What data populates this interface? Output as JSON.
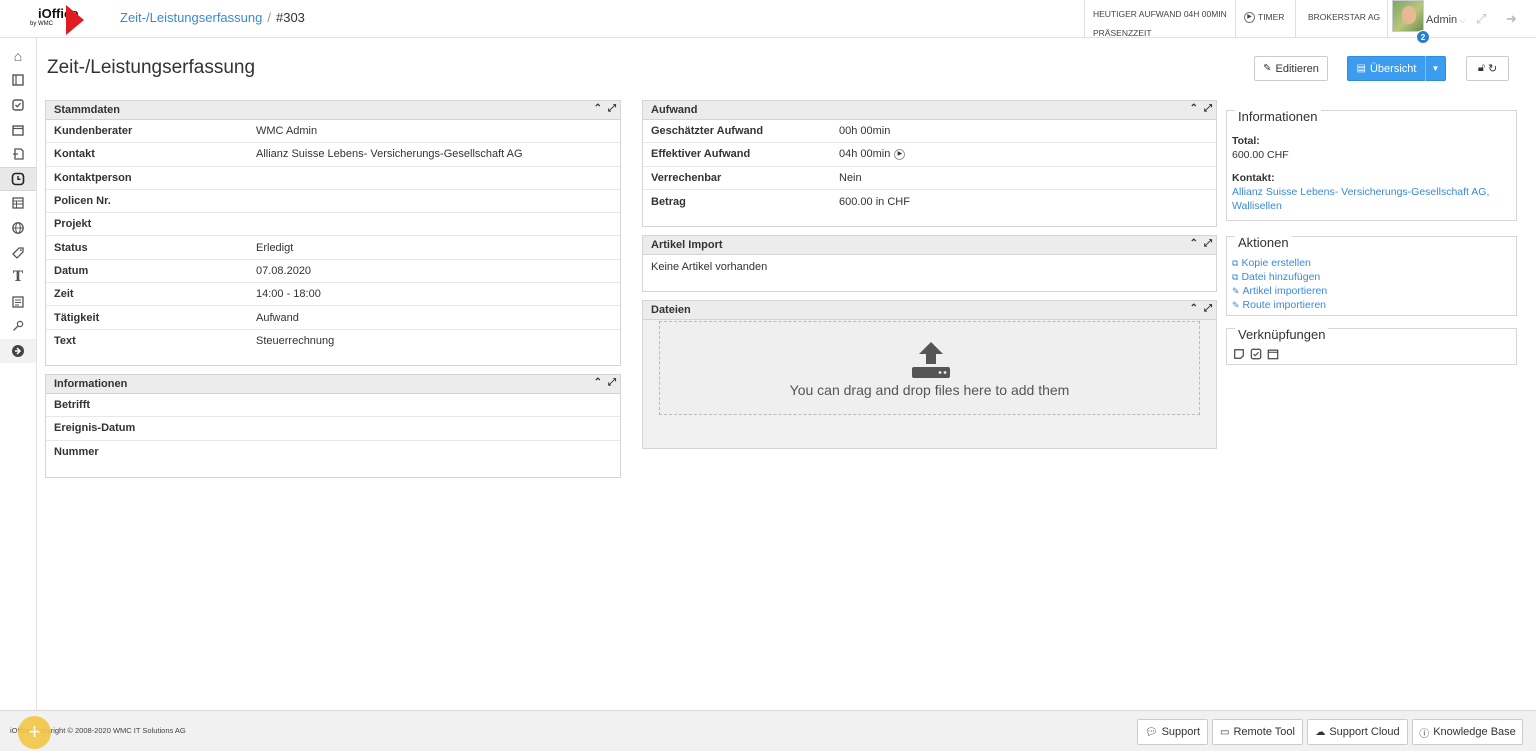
{
  "header": {
    "breadcrumb_link": "Zeit-/Leistungserfassung",
    "breadcrumb_sep": "/",
    "breadcrumb_current": "#303",
    "effort_line1": "HEUTIGER AUFWAND 04H 00MIN",
    "effort_line2": "PRÄSENZZEIT",
    "timer_label": "TIMER",
    "company": "BROKERSTAR AG",
    "user_name": "Admin",
    "notification_count": "2",
    "logo_text": "iOffice",
    "logo_sub": "by WMC"
  },
  "page": {
    "title": "Zeit-/Leistungserfassung",
    "edit_button": "Editieren",
    "overview_button": "Übersicht"
  },
  "stammdaten": {
    "title": "Stammdaten",
    "rows": [
      {
        "label": "Kundenberater",
        "value": "WMC Admin"
      },
      {
        "label": "Kontakt",
        "value": "Allianz Suisse Lebens- Versicherungs-Gesellschaft AG"
      },
      {
        "label": "Kontaktperson",
        "value": ""
      },
      {
        "label": "Policen Nr.",
        "value": ""
      },
      {
        "label": "Projekt",
        "value": ""
      },
      {
        "label": "Status",
        "value": "Erledigt"
      },
      {
        "label": "Datum",
        "value": "07.08.2020"
      },
      {
        "label": "Zeit",
        "value": "14:00 - 18:00"
      },
      {
        "label": "Tätigkeit",
        "value": "Aufwand"
      },
      {
        "label": "Text",
        "value": "Steuerrechnung"
      }
    ]
  },
  "informationen_panel": {
    "title": "Informationen",
    "rows": [
      {
        "label": "Betrifft",
        "value": ""
      },
      {
        "label": "Ereignis-Datum",
        "value": ""
      },
      {
        "label": "Nummer",
        "value": ""
      }
    ]
  },
  "aufwand": {
    "title": "Aufwand",
    "rows": [
      {
        "label": "Geschätzter Aufwand",
        "value": "00h 00min"
      },
      {
        "label": "Effektiver Aufwand",
        "value": "04h 00min"
      },
      {
        "label": "Verrechenbar",
        "value": "Nein"
      },
      {
        "label": "Betrag",
        "value": "600.00 in CHF"
      }
    ]
  },
  "artikel_import": {
    "title": "Artikel Import",
    "empty_text": "Keine Artikel vorhanden"
  },
  "dateien": {
    "title": "Dateien",
    "drop_text": "You can drag and drop files here to add them"
  },
  "info_box": {
    "legend": "Informationen",
    "total_label": "Total:",
    "total_value": "600.00 CHF",
    "contact_label": "Kontakt:",
    "contact_value_1": "Allianz Suisse Lebens- Versicherungs-Gesellschaft AG,",
    "contact_value_2": "Wallisellen"
  },
  "actions_box": {
    "legend": "Aktionen",
    "items": [
      "Kopie erstellen",
      "Datei hinzufügen",
      "Artikel importieren",
      "Route importieren"
    ]
  },
  "links_box": {
    "legend": "Verknüpfungen"
  },
  "footer": {
    "copyright": "iOffice Copyright © 2008-2020 WMC IT Solutions AG",
    "support": "Support",
    "remote_tool": "Remote Tool",
    "support_cloud": "Support Cloud",
    "knowledge_base": "Knowledge Base"
  },
  "colors": {
    "accent_blue": "#3c9cf0",
    "link_blue": "#3a8ad6",
    "logo_red": "#e01b22",
    "fab_yellow": "#f3c646"
  }
}
